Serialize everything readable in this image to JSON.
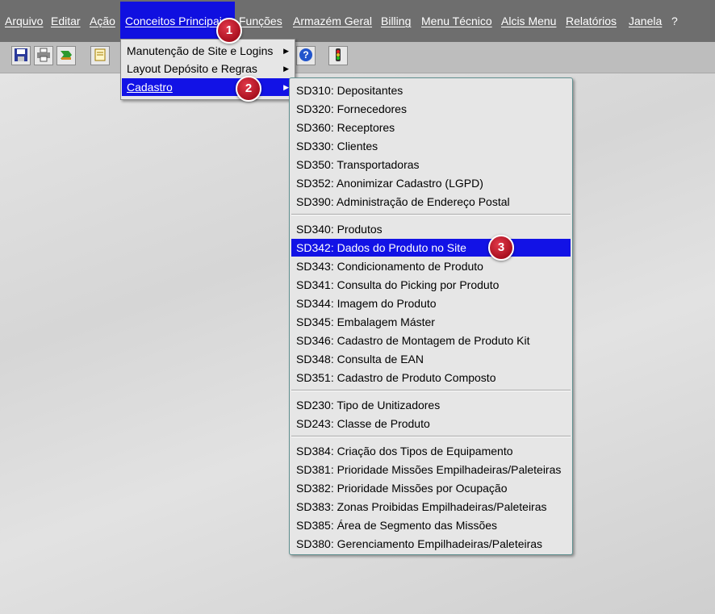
{
  "menubar": {
    "items": [
      {
        "label": "Arquivo"
      },
      {
        "label": "Editar"
      },
      {
        "label": "Ação"
      },
      {
        "label": "Conceitos Principais"
      },
      {
        "label": "Funções"
      },
      {
        "label": "Armazém Geral"
      },
      {
        "label": "Billing"
      },
      {
        "label": "Menu Técnico"
      },
      {
        "label": "Alcis Menu"
      },
      {
        "label": "Relatórios"
      },
      {
        "label": "Janela"
      },
      {
        "label": "?"
      }
    ],
    "active_item": "Conceitos Principais"
  },
  "toolbar": {
    "icons": [
      "save-icon",
      "print-icon",
      "green-arrow-icon",
      "document-icon",
      "help-icon",
      "traffic-light-icon"
    ]
  },
  "submenu_conceitos": {
    "items": [
      {
        "label": "Manutenção de Site e Logins",
        "has_submenu": true
      },
      {
        "label": "Layout Depósito e Regras",
        "has_submenu": true
      },
      {
        "label": "Cadastro",
        "has_submenu": true,
        "selected": true
      }
    ]
  },
  "submenu_cadastro": {
    "groups": [
      [
        {
          "code": "SD310",
          "label": ": Depositantes"
        },
        {
          "code": "SD320",
          "label": ": Fornecedores"
        },
        {
          "code": "SD360",
          "label": ": Receptores"
        },
        {
          "code": "SD330",
          "label": ": Clientes"
        },
        {
          "code": "SD350",
          "label": ": Transportadoras"
        },
        {
          "code": "SD352",
          "label": ": Anonimizar Cadastro (LGPD)"
        },
        {
          "code": "SD390",
          "label": ": Administração de Endereço Postal"
        }
      ],
      [
        {
          "code": "SD340",
          "label": ": Produtos"
        },
        {
          "code": "SD342",
          "label": ": Dados do Produto no Site",
          "selected": true
        },
        {
          "code": "SD343",
          "label": ": Condicionamento de Produto"
        },
        {
          "code": "SD341",
          "label": ": Consulta do Picking por Produto"
        },
        {
          "code": "SD344",
          "label": ": Imagem do Produto"
        },
        {
          "code": "SD345",
          "label": ": Embalagem Máster"
        },
        {
          "code": "SD346",
          "label": ": Cadastro de Montagem de  Produto Kit"
        },
        {
          "code": "SD348",
          "label": ": Consulta de EAN"
        },
        {
          "code": "SD351",
          "label": ": Cadastro de Produto Composto"
        }
      ],
      [
        {
          "code": "SD230",
          "label": ": Tipo de Unitizadores"
        },
        {
          "code": "SD243",
          "label": ": Classe de Produto"
        }
      ],
      [
        {
          "code": "SD384",
          "label": ": Criação dos Tipos de Equipamento"
        },
        {
          "code": "SD381",
          "label": ": Prioridade Missões Empilhadeiras/Paleteiras"
        },
        {
          "code": "SD382",
          "label": ": Prioridade Missões por Ocupação"
        },
        {
          "code": "SD383",
          "label": ": Zonas Proibidas Empilhadeiras/Paleteiras"
        },
        {
          "code": "SD385",
          "label": ": Área de Segmento das Missões"
        },
        {
          "code": "SD380",
          "label": ": Gerenciamento Empilhadeiras/Paleteiras"
        }
      ]
    ]
  },
  "annotations": {
    "step1": "1",
    "step2": "2",
    "step3": "3"
  },
  "colors": {
    "menubar_bg": "#6e6e6e",
    "highlight": "#1212e6",
    "menu_bg": "#e6e6e6",
    "badge": "#c41e2e"
  }
}
